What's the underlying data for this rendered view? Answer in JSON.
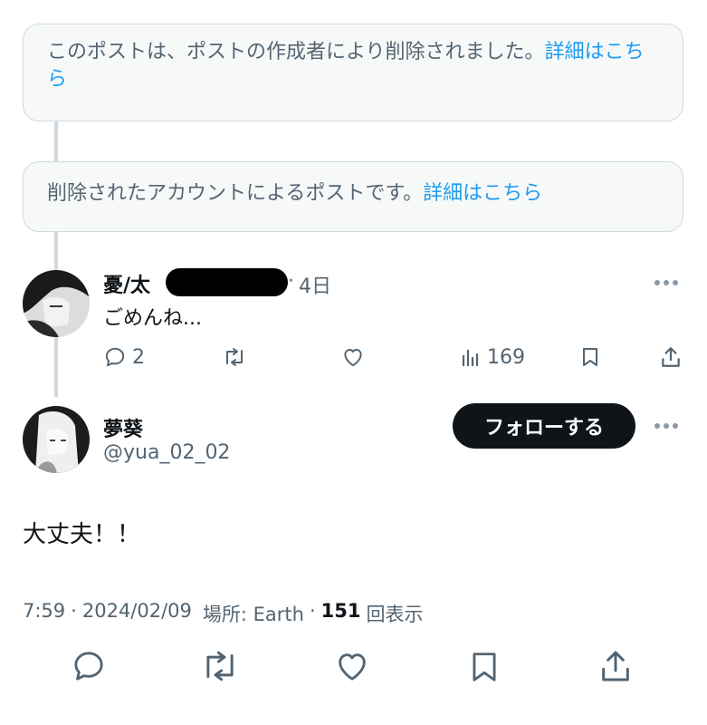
{
  "notices": {
    "deleted_by_author": {
      "text": "このポストは、ポストの作成者により削除されました。",
      "link": "詳細はこちら"
    },
    "deleted_account": {
      "text": "削除されたアカウントによるポストです。",
      "link": "詳細はこちら"
    }
  },
  "reply": {
    "name": "憂/太",
    "separator": "·",
    "time": "4日",
    "text": "ごめんね...",
    "reply_count": "2",
    "view_count": "169"
  },
  "main": {
    "name": "夢葵",
    "handle": "@yua_02_02",
    "follow_label": "フォローする",
    "text": "大丈夫！！",
    "meta": {
      "time": "7:59",
      "sep1": "·",
      "date": "2024/02/09",
      "location": "場所: Earth",
      "sep2": "·",
      "views_count": "151",
      "views_label": "回表示"
    }
  },
  "icons": {
    "reply": "reply-icon",
    "repost": "repost-icon",
    "like": "like-icon",
    "views": "views-icon",
    "bookmark": "bookmark-icon",
    "share": "share-icon",
    "more": "more-icon"
  },
  "colors": {
    "link": "#1d9bf0",
    "muted": "#536471",
    "follow_bg": "#0f1419"
  }
}
